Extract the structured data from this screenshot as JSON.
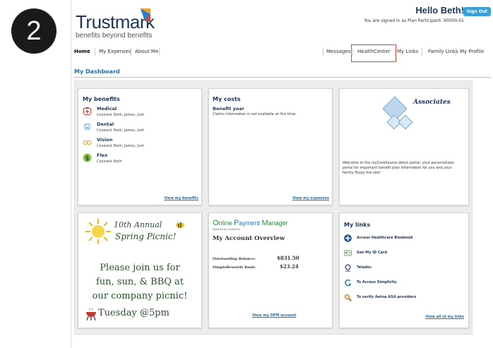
{
  "step_number": "2",
  "brand": {
    "name": "Trustmark",
    "tagline": "benefits beyond benefits"
  },
  "header": {
    "greeting": "Hello Beth!",
    "signout_label": "Sign Out",
    "signed_in_text": "You are signed in as Plan Participant: X0000-01"
  },
  "nav": {
    "left": [
      "Home",
      "My Expenses",
      "About Me"
    ],
    "right": [
      "Messages",
      "HealthCenter",
      "My Links",
      "Family Links",
      "My Profile"
    ]
  },
  "dashboard_title": "My Dashboard",
  "benefits_card": {
    "title": "My benefits",
    "items": [
      {
        "name": "Medical",
        "covered": "Covered: Beth, James, Josh",
        "icon": "medical-icon"
      },
      {
        "name": "Dental",
        "covered": "Covered: Beth, James, Josh",
        "icon": "dental-icon"
      },
      {
        "name": "Vision",
        "covered": "Covered: Beth, James, Josh",
        "icon": "vision-icon"
      },
      {
        "name": "Flex",
        "covered": "Covered: Beth",
        "icon": "flex-icon"
      }
    ],
    "link": "View my benefits"
  },
  "costs_card": {
    "title": "My costs",
    "subtitle": "Benefit year",
    "note": "Claims information is not available at this time.",
    "link": "View my expenses"
  },
  "associates_card": {
    "logo_text": "Associates",
    "welcome": "Welcome to the myCoreSource demo portal, your personalized portal for important benefit plan information for you and your family. Enjoy the site!"
  },
  "picnic_card": {
    "line1": "10th Annual",
    "line2": "Spring Picnic!",
    "line3": "Please join us for",
    "line4": "fun, sun, & BBQ at",
    "line5": "our company picnic!",
    "line6": "Tuesday @5pm"
  },
  "opm_card": {
    "brand_o": "O",
    "brand_nline": "nline ",
    "brand_p": "P",
    "brand_ayment": "ayment ",
    "brand_m": "M",
    "brand_anager": "anager",
    "powered": "Powered by Simplicity",
    "title": "My Account Overview",
    "rows": [
      {
        "label": "Outstanding Balance:",
        "value": "$831.50"
      },
      {
        "label": "SimpleRewards Bank:",
        "value": "$23.24"
      }
    ],
    "link": "View my OPM account"
  },
  "links_card": {
    "title": "My links",
    "items": [
      {
        "label": "Access Healthcare Bluebook",
        "icon": "bluebook-icon"
      },
      {
        "label": "See My ID Card",
        "icon": "id-card-icon"
      },
      {
        "label": "Teladoc",
        "icon": "teladoc-icon"
      },
      {
        "label": "To Access Simplicity",
        "icon": "simplicity-icon"
      },
      {
        "label": "To verify Aetna ASA providers",
        "icon": "search-provider-icon"
      }
    ],
    "link": "View all of my links"
  },
  "colors": {
    "highlight": "#e0402f",
    "link": "#1f6fb0",
    "navy": "#1d3557",
    "signout": "#3aa0d8"
  }
}
